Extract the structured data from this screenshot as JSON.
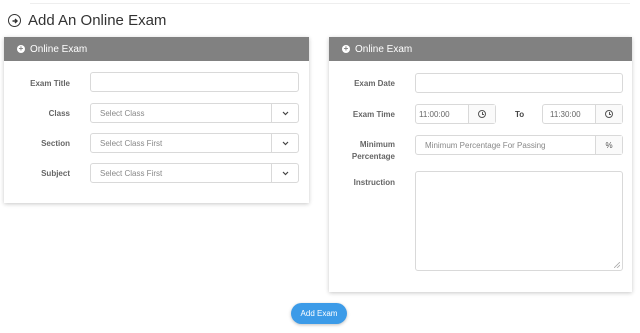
{
  "page": {
    "title": "Add An Online Exam"
  },
  "left_card": {
    "title": "Online Exam",
    "exam_title": {
      "label": "Exam Title",
      "value": ""
    },
    "class": {
      "label": "Class",
      "value": "Select Class"
    },
    "section": {
      "label": "Section",
      "value": "Select Class First"
    },
    "subject": {
      "label": "Subject",
      "value": "Select Class First"
    }
  },
  "right_card": {
    "title": "Online Exam",
    "exam_date": {
      "label": "Exam Date",
      "value": ""
    },
    "exam_time": {
      "label": "Exam Time",
      "from": "11:00:00",
      "to_label": "To",
      "to": "11:30:00"
    },
    "minimum_percentage": {
      "label_line1": "Minimum",
      "label_line2": "Percentage",
      "placeholder": "Minimum Percentage For Passing",
      "addon": "%"
    },
    "instruction": {
      "label": "Instruction",
      "value": ""
    }
  },
  "actions": {
    "submit_label": "Add Exam"
  },
  "colors": {
    "header_bg": "#818181",
    "button_bg": "#3c9be8"
  }
}
